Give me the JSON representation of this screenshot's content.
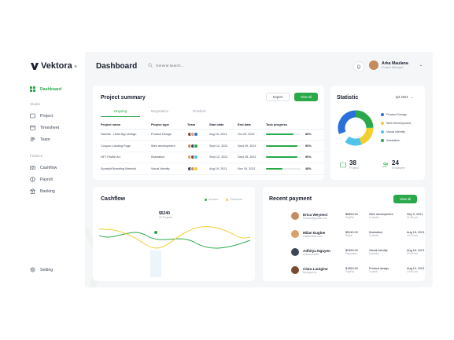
{
  "brand": {
    "name": "Vektora",
    "mark": "V"
  },
  "sidebar": {
    "dashboard": "Dashboard",
    "studio_title": "Studio",
    "studio_items": [
      "Project",
      "Timesheet",
      "Team"
    ],
    "finance_title": "Finance",
    "finance_items": [
      "Cashflow",
      "Payroll",
      "Banking"
    ],
    "setting": "Setting"
  },
  "header": {
    "title": "Dashboard",
    "search_placeholder": "General search...",
    "user_name": "Arka Maulana",
    "user_role": "Project Manager"
  },
  "project_summary": {
    "title": "Project summary",
    "export": "Export",
    "view_all": "View all",
    "tabs": [
      "Ongoing",
      "Negotiation",
      "Finished"
    ],
    "columns": [
      "Project name",
      "Project type",
      "Team",
      "Start date",
      "End date",
      "Task progress"
    ],
    "rows": [
      {
        "name": "Dworkk - Hotel App Design",
        "type": "Product Design",
        "start": "Aug 15, 2021",
        "end": "Oct 29, 2021",
        "progress": 80,
        "progress_label": "80%"
      },
      {
        "name": "Coupon Landing Page",
        "type": "Web development",
        "start": "Sept 12, 2021",
        "end": "Sept 29, 2021",
        "progress": 90,
        "progress_label": "90%"
      },
      {
        "name": "NFT Profile Art",
        "type": "Illustration",
        "start": "Sept 12, 2021",
        "end": "Sept 28, 2021",
        "progress": 90,
        "progress_label": "90%"
      },
      {
        "name": "Sportyid Branding Material",
        "type": "Visual Identity",
        "start": "Aug 19, 2021",
        "end": "Nov 18, 2021",
        "progress": 48,
        "progress_label": "48%"
      }
    ]
  },
  "statistic": {
    "title": "Statistic",
    "period": "Q4 2021",
    "legend": [
      {
        "label": "Product Design",
        "color": "#2a6fdb"
      },
      {
        "label": "Web Development",
        "color": "#f2cf2e"
      },
      {
        "label": "Visual Identity",
        "color": "#4fc3e8"
      },
      {
        "label": "Illustration",
        "color": "#2aa84a"
      }
    ],
    "project_count": "38",
    "project_label": "Project",
    "employee_count": "24",
    "employee_label": "Employee"
  },
  "cashflow": {
    "title": "Cashflow",
    "legend_income": "Income",
    "legend_outcome": "Outcome",
    "tooltip_value": "$5240",
    "tooltip_date": "15 Projects",
    "months": [
      "Jan",
      "Feb",
      "Mar",
      "Apr",
      "May",
      "Jun",
      "Jul",
      "Aug",
      "Sep",
      "Oct",
      "Nov",
      "Dec"
    ],
    "colors": {
      "income": "#2aa84a",
      "outcome": "#f2cf2e"
    }
  },
  "recent_payment": {
    "title": "Recent payment",
    "view_all": "View all",
    "rows": [
      {
        "name": "Erica Weynect",
        "email": "Product@gmail.com",
        "amount": "$6850.00",
        "method": "PayPal",
        "type": "Web development",
        "detail": "5 weeks",
        "date": "Sep 3, 2021",
        "time": "11:35 pm"
      },
      {
        "name": "Milan Euglne",
        "email": "Cafebuilder.com",
        "amount": "$5240.00",
        "method": "Stripe",
        "type": "Illustration",
        "detail": "2 weeks",
        "date": "Aug 18, 2021",
        "time": "10:15 am"
      },
      {
        "name": "Adhitya Nguyen",
        "email": "Coinroot.com",
        "amount": "$2450.00",
        "method": "Payoneer",
        "type": "Visual Identity",
        "detail": "5 weeks",
        "date": "Aug 16, 2021",
        "time": "09:00 am"
      },
      {
        "name": "Clara Lauigine",
        "email": "Budspec.id",
        "amount": "$1850.00",
        "method": "PayPal",
        "type": "Product design",
        "detail": "1 week",
        "date": "Aug 10, 2021",
        "time": "14:50 pm"
      }
    ]
  }
}
